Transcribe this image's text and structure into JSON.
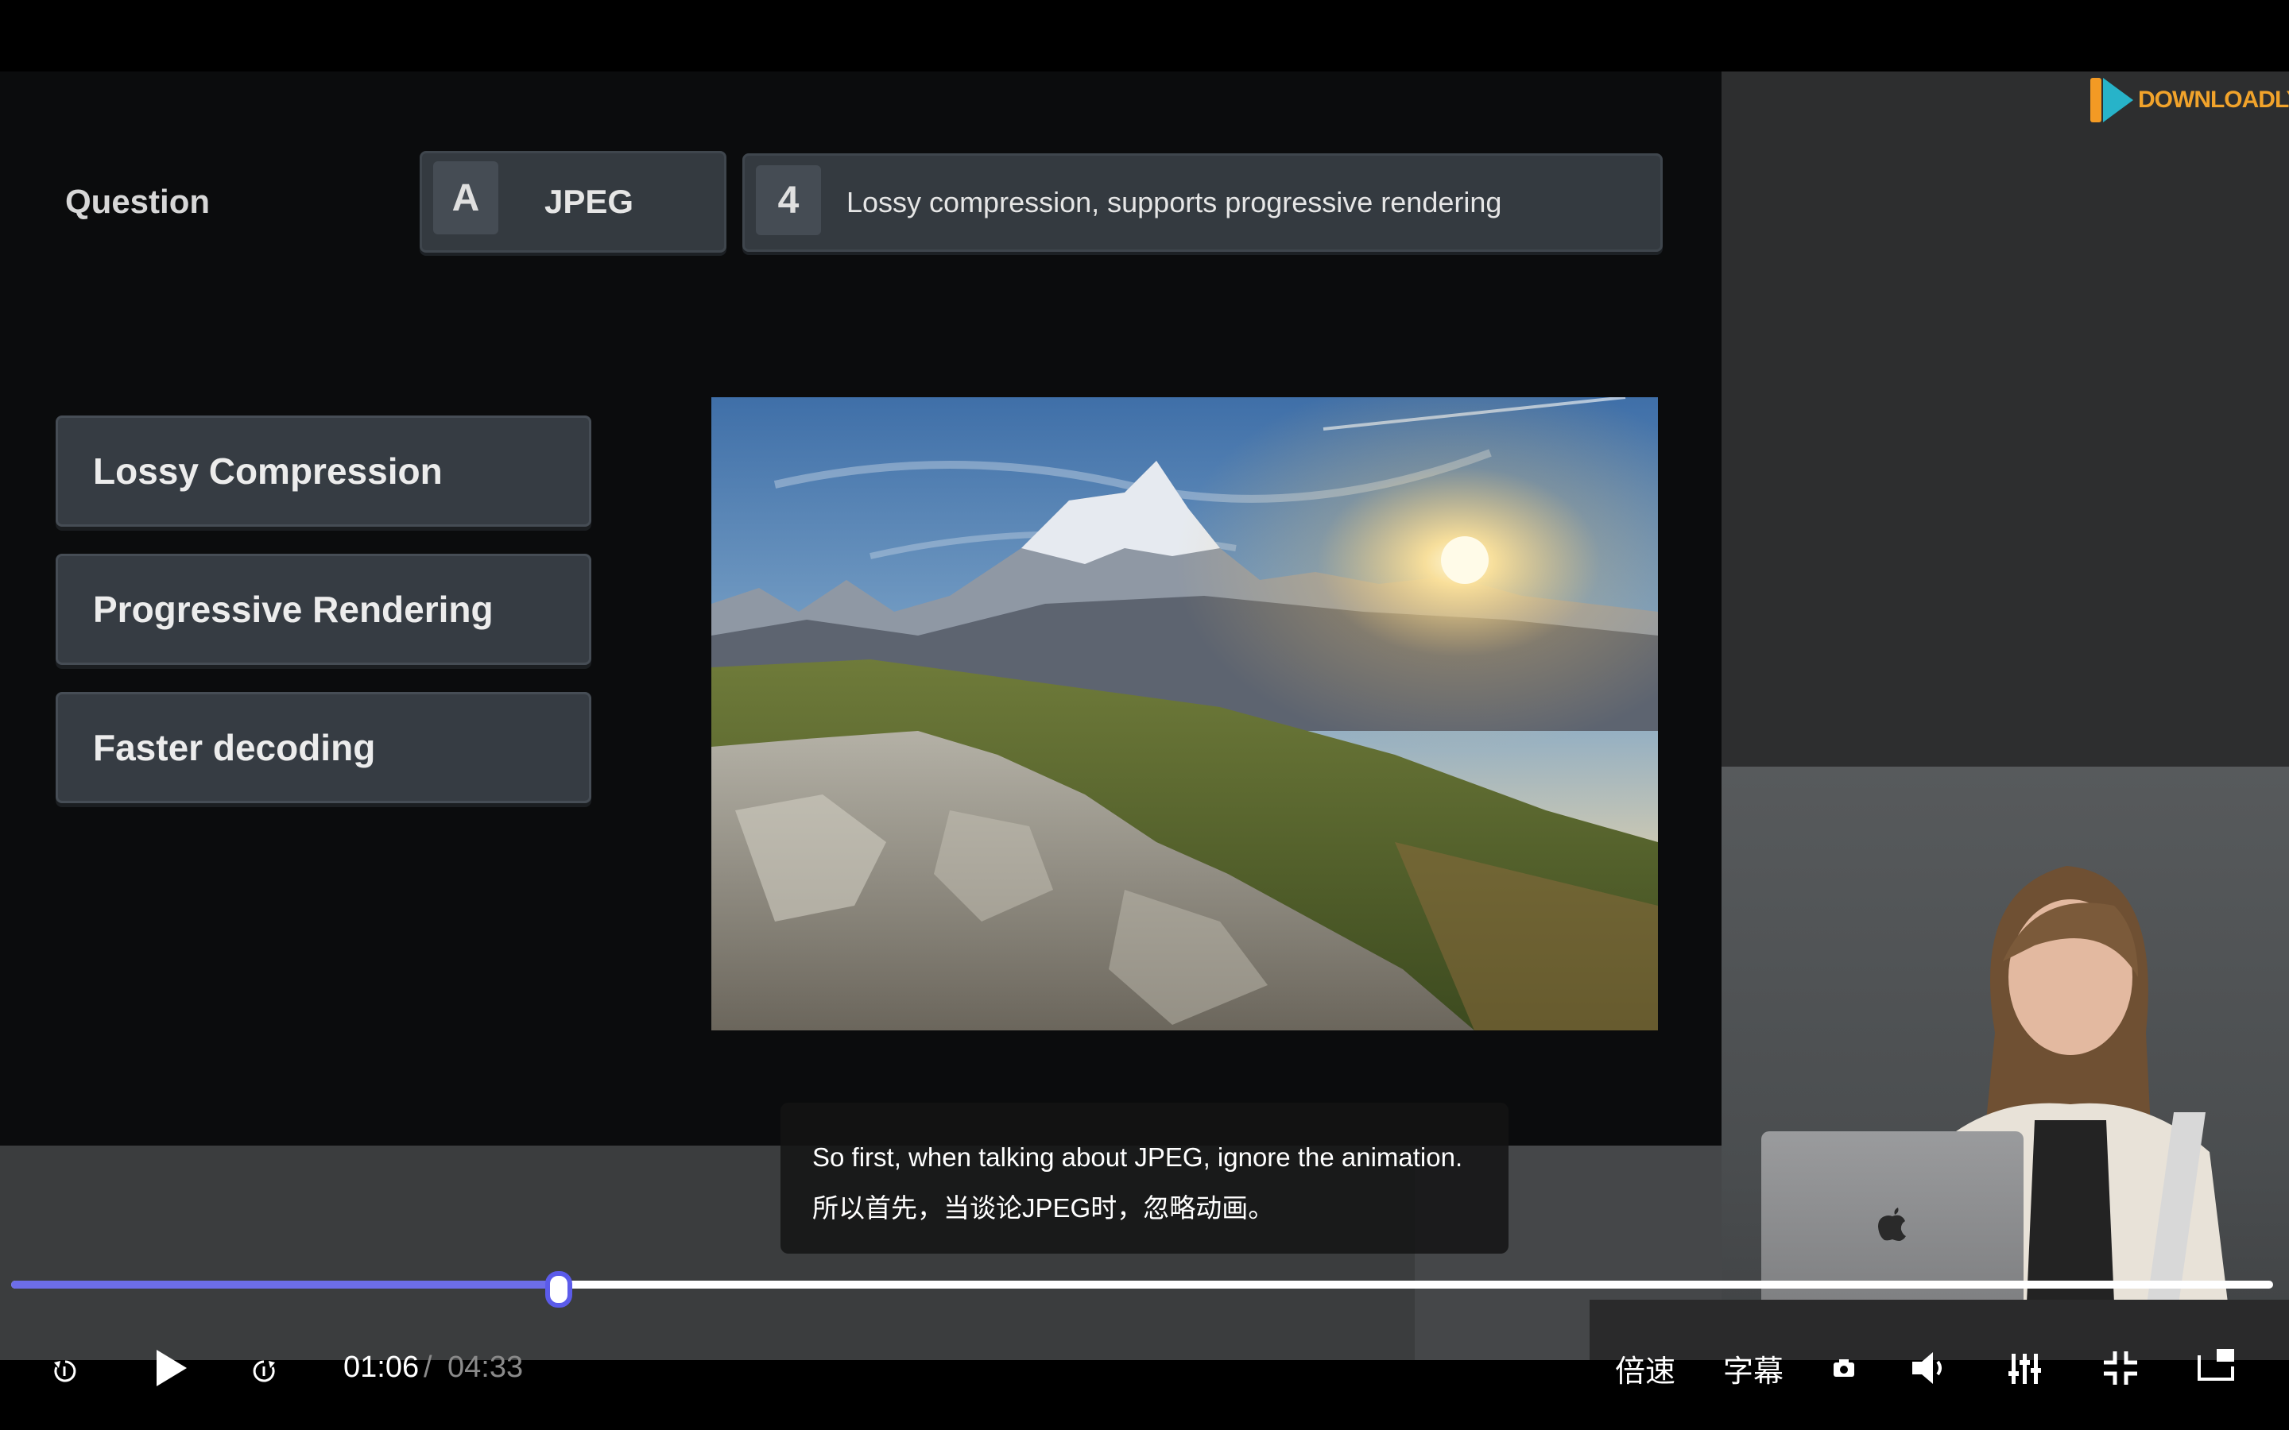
{
  "slide": {
    "question_label": "Question",
    "answer_letter": "A",
    "answer_value": "JPEG",
    "answer_number": "4",
    "answer_description": "Lossy compression, supports progressive rendering",
    "options": [
      "Lossy Compression",
      "Progressive Rendering",
      "Faster decoding"
    ]
  },
  "watermark": {
    "text": "DOWNLOADLY.IR"
  },
  "caption": {
    "en": "So first, when talking about JPEG, ignore the animation.",
    "zh": "所以首先，当谈论JPEG时，忽略动画。"
  },
  "player": {
    "progress": 0.242,
    "current_time": "01:06",
    "separator": "/",
    "total_time": "04:33",
    "speed_label": "倍速",
    "subtitle_label": "字幕",
    "icons": {
      "rewind": "rewind-icon",
      "play": "play-icon",
      "forward": "forward-icon",
      "screenshot": "camera-icon",
      "volume": "volume-icon",
      "settings": "equalizer-icon",
      "exit_fullscreen": "exit-fullscreen-icon",
      "picture_in_picture": "pip-icon"
    },
    "accent_color": "#6d6de8"
  }
}
